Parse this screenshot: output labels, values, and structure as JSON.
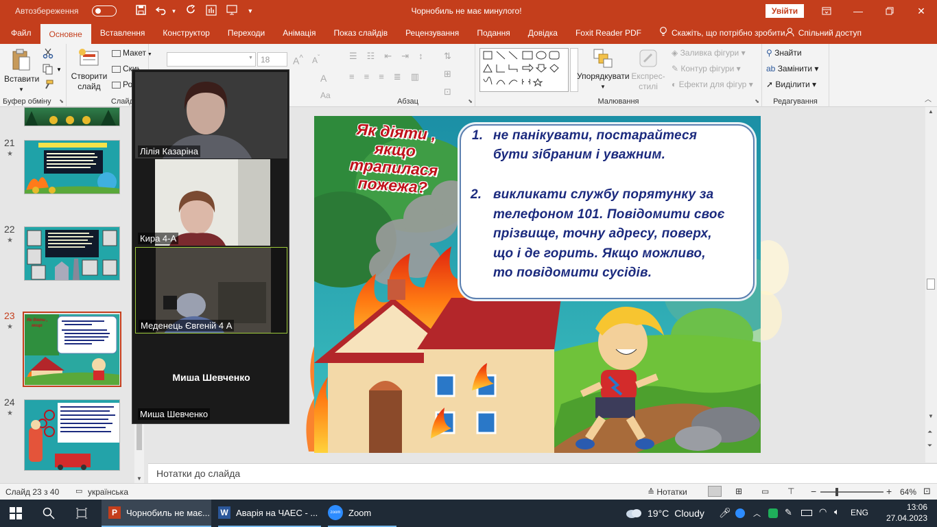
{
  "titlebar": {
    "autosave_label": "Автозбереження",
    "doc_title": "Чорнобиль не має минулого!",
    "signin_label": "Увійти"
  },
  "tabs": [
    "Файл",
    "Основне",
    "Вставлення",
    "Конструктор",
    "Переходи",
    "Анімація",
    "Показ слайдів",
    "Рецензування",
    "Подання",
    "Довідка",
    "Foxit Reader PDF"
  ],
  "tell_me": "Скажіть, що потрібно зробити",
  "share_label": "Спільний доступ",
  "ribbon": {
    "paste": "Вставити",
    "clipboard_group": "Буфер обміну",
    "new_slide": "Створити слайд",
    "layout": "Макет",
    "reset": "Скинути",
    "section": "Ро",
    "slides_group": "Слайди",
    "font_size": "18",
    "paragraph_group": "Абзац",
    "arrange": "Упорядкувати",
    "quick_styles": "Експрес-стилі",
    "shape_fill": "Заливка фігури",
    "shape_outline": "Контур фігури",
    "shape_effects": "Ефекти для фігур",
    "drawing_group": "Малювання",
    "find": "Знайти",
    "replace": "Замінити",
    "select": "Виділити",
    "editing_group": "Редагування"
  },
  "thumbnails": [
    {
      "num": "21",
      "star": "★"
    },
    {
      "num": "22",
      "star": "★"
    },
    {
      "num": "23",
      "star": "★"
    },
    {
      "num": "24",
      "star": "★"
    }
  ],
  "zoom": {
    "participants": [
      {
        "name": "Лілія Казаріна"
      },
      {
        "name": "Кира 4-А"
      },
      {
        "name": "Меденець Євгеній 4 А"
      },
      {
        "name": "Миша Шевченко"
      }
    ],
    "center_name": "Миша Шевченко"
  },
  "slide": {
    "question_lines": [
      "Як діяти ,",
      "якщо",
      "трапилася",
      "пожежа?"
    ],
    "items": [
      {
        "num": "1.",
        "lines": [
          "не панікувати, постарайтеся",
          "бути зібраним і уважним."
        ]
      },
      {
        "num": "2.",
        "lines": [
          "викликати службу порятунку за",
          "телефоном 101. Повідомити своє",
          "прізвище, точну адресу, поверх,",
          "що і де горить. Якщо можливо,",
          "то повідомити сусідів."
        ]
      }
    ]
  },
  "notes_placeholder": "Нотатки до слайда",
  "status": {
    "slide_counter": "Слайд 23 з 40",
    "language": "українська",
    "notes_btn": "Нотатки",
    "zoom_level": "64%"
  },
  "taskbar": {
    "apps": [
      {
        "label": "Чорнобиль не має..."
      },
      {
        "label": "Аварія на ЧАЕС - ..."
      },
      {
        "label": "Zoom"
      }
    ],
    "zoom_icon_text": "zoom",
    "weather_temp": "19°C",
    "weather_desc": "Cloudy",
    "lang": "ENG",
    "time": "13:06",
    "date": "27.04.2023"
  },
  "colors": {
    "accent": "#c43e1c",
    "question_red": "#c0121b",
    "item_blue": "#1b2a7e",
    "taskbar": "#1f2a36"
  }
}
